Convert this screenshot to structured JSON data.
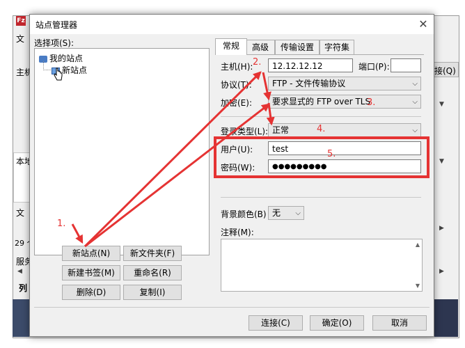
{
  "background": {
    "menu_fragment": "文",
    "host_fragment": "主机",
    "local_fragment": "本地",
    "file_fragment": "文",
    "count_fragment": "29 个",
    "server_fragment": "服务",
    "queue_fragment": "列",
    "connect_fragment": "接(Q)"
  },
  "dialog": {
    "title": "站点管理器",
    "select_entry_label": "选择项(S):",
    "tree": {
      "root": "我的站点",
      "child": "新站点"
    },
    "buttons": {
      "new_site": "新站点(N)",
      "new_folder": "新文件夹(F)",
      "new_bookmark": "新建书签(M)",
      "rename": "重命名(R)",
      "delete": "删除(D)",
      "copy": "复制(I)",
      "connect": "连接(C)",
      "ok": "确定(O)",
      "cancel": "取消"
    },
    "tabs": [
      "常规",
      "高级",
      "传输设置",
      "字符集"
    ],
    "general": {
      "host_label": "主机(H):",
      "host_value": "12.12.12.12",
      "port_label": "端口(P):",
      "port_value": "",
      "protocol_label": "协议(T):",
      "protocol_value": "FTP - 文件传输协议",
      "encryption_label": "加密(E):",
      "encryption_value": "要求显式的 FTP over TLS",
      "logon_type_label": "登录类型(L):",
      "logon_type_value": "正常",
      "user_label": "用户(U):",
      "user_value": "test",
      "password_label": "密码(W):",
      "password_value": "●●●●●●●●●",
      "bg_color_label": "背景颜色(B)",
      "bg_color_value": "无",
      "comments_label": "注释(M):"
    }
  },
  "annotations": {
    "step1": "1.",
    "step2": "2.",
    "step3": "3.",
    "step4": "4.",
    "step5": "5."
  },
  "colors": {
    "annotation_red": "#e53333"
  }
}
